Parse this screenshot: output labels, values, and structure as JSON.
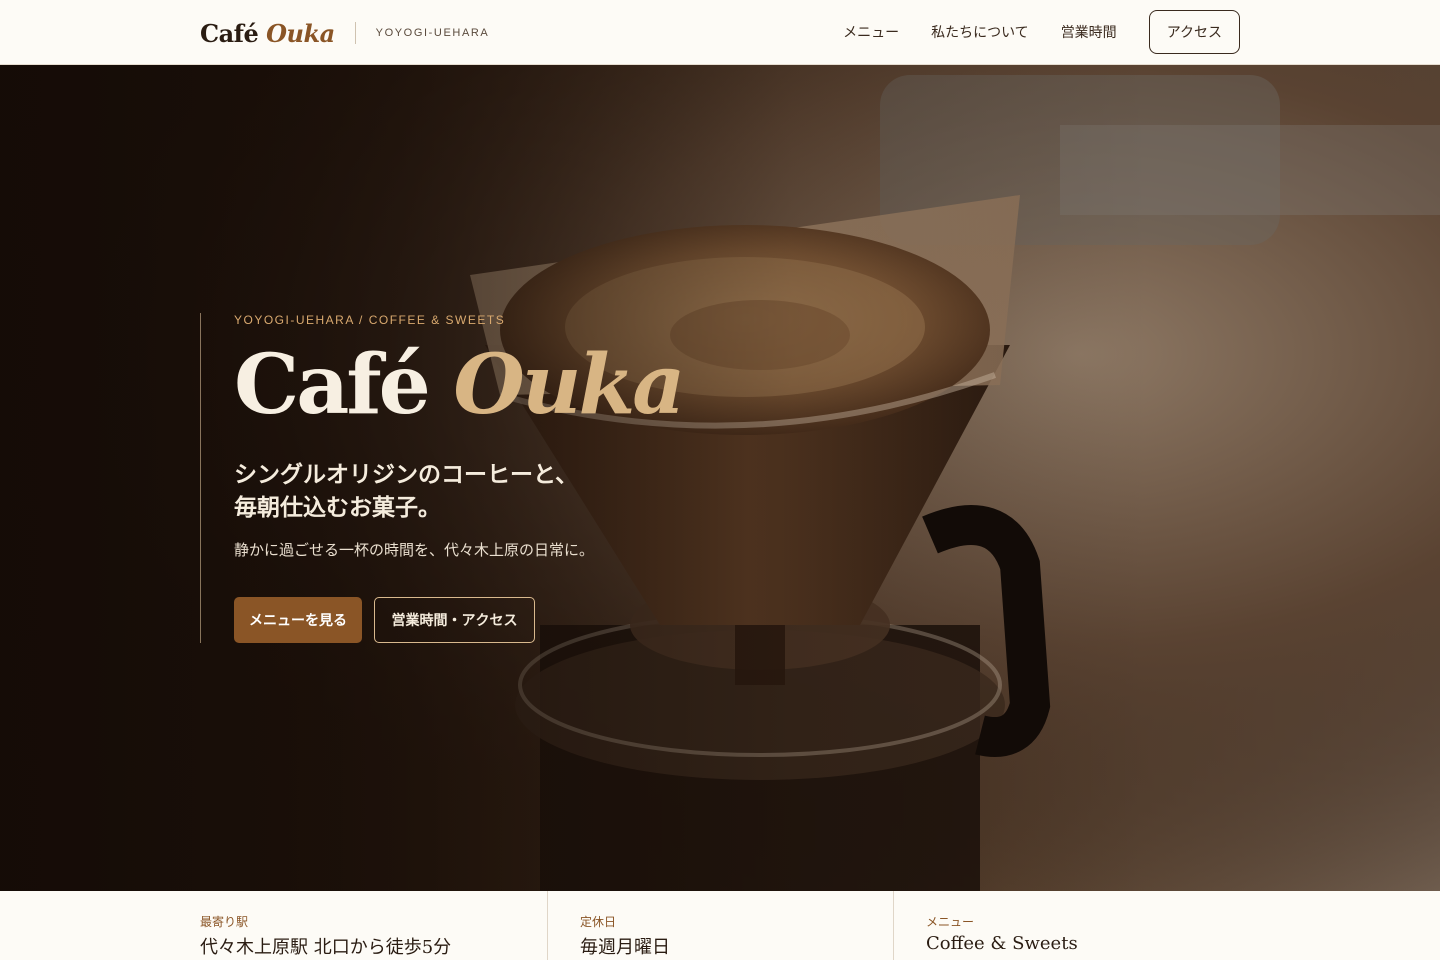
{
  "header": {
    "logo_main": "Café",
    "logo_accent": "Ouka",
    "location": "YOYOGI-UEHARA",
    "nav": [
      {
        "label": "メニュー"
      },
      {
        "label": "私たちについて"
      },
      {
        "label": "営業時間"
      }
    ],
    "cta_label": "アクセス"
  },
  "hero": {
    "eyebrow": "YOYOGI-UEHARA / COFFEE & SWEETS",
    "title_main": "Café",
    "title_accent": "Ouka",
    "tagline_line1": "シングルオリジンのコーヒーと、",
    "tagline_line2": "毎朝仕込むお菓子。",
    "description": "静かに過ごせる一杯の時間を、代々木上原の日常に。",
    "primary_button": "メニューを見る",
    "secondary_button": "営業時間・アクセス"
  },
  "info": [
    {
      "label": "最寄り駅",
      "value": "代々木上原駅 北口から徒歩5分"
    },
    {
      "label": "定休日",
      "value": "毎週月曜日"
    },
    {
      "label": "メニュー",
      "value": "Coffee & Sweets"
    }
  ],
  "colors": {
    "accent": "#8a5526",
    "background": "#fdfbf6",
    "hero_dark": "#1d120b",
    "title_accent": "#d8b584"
  }
}
